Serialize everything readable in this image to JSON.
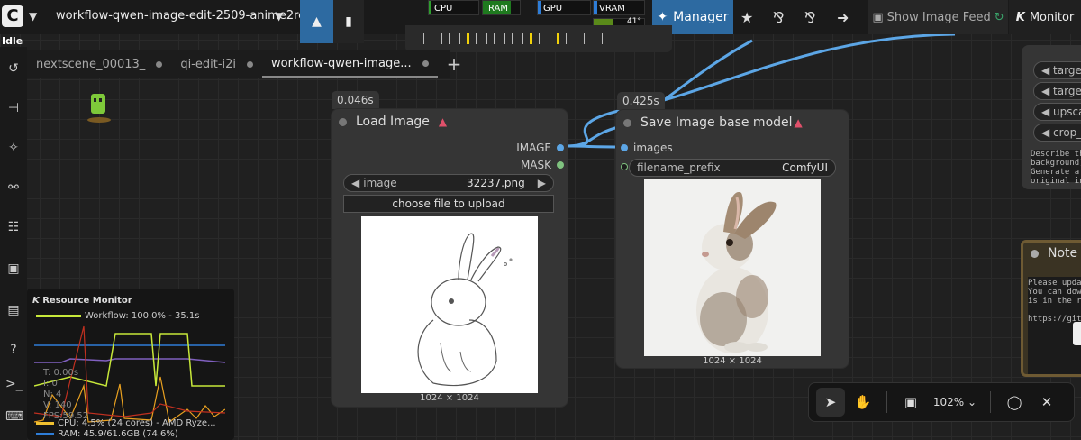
{
  "topbar": {
    "workflow_title": "workflow-qwen-image-edit-2509-anime2re...",
    "status": "Idle",
    "meters": [
      {
        "label": "CPU",
        "percent": 4.5,
        "color": "#2e9e2e"
      },
      {
        "label": "RAM",
        "percent": 74.6,
        "color": "#1f7a1f"
      },
      {
        "label": "GPU",
        "percent": 0,
        "color": "#2e7dd7"
      },
      {
        "label": "VRAM",
        "percent": 0,
        "color": "#2e7dd7"
      }
    ],
    "temp": "41°",
    "manager_label": "Manager",
    "show_feed_label": "Show Image Feed",
    "monitor_label": "Monitor"
  },
  "tabs": [
    {
      "label": "nextscene_00013_",
      "active": false
    },
    {
      "label": "qi-edit-i2i",
      "active": false
    },
    {
      "label": "workflow-qwen-image...",
      "active": true
    }
  ],
  "nodes": {
    "load_image": {
      "timer": "0.046s",
      "title": "Load Image",
      "outputs": [
        {
          "label": "IMAGE",
          "color": "#5ca6e6"
        },
        {
          "label": "MASK",
          "color": "#7fc27f"
        }
      ],
      "image_widget_label": "image",
      "image_widget_value": "32237.png",
      "upload_button": "choose file to upload",
      "dims": "1024 × 1024"
    },
    "save_image": {
      "timer": "0.425s",
      "title": "Save Image base model",
      "input_label": "images",
      "prefix_label": "filename_prefix",
      "prefix_value": "ComfyUI",
      "dims": "1024 × 1024"
    },
    "right_node": {
      "pills": [
        "target_",
        "target_",
        "upscal",
        "crop_n"
      ],
      "text": "Describe the\nbackground).\nGenerate a n\noriginal inp"
    },
    "note": {
      "title": "Note",
      "text": "Please updat\nYou can down\nis in the re\n\nhttps://gith"
    }
  },
  "resource_monitor": {
    "title": "Resource Monitor",
    "workflow_legend": "Workflow: 100.0% - 35.1s",
    "overlay": [
      "T: 0.00s",
      "I: 0",
      "N: 4",
      "V: 140",
      "FPS:59.52"
    ],
    "cpu_legend": "CPU: 4.5% (24 cores) - AMD Ryze...",
    "ram_legend": "RAM: 45.9/61.6GB (74.6%)",
    "legend_colors": {
      "workflow": "#c7e83a",
      "cpu": "#f0c030",
      "ram": "#2e7dd7"
    }
  },
  "canvas_toolbar": {
    "zoom": "102%"
  }
}
